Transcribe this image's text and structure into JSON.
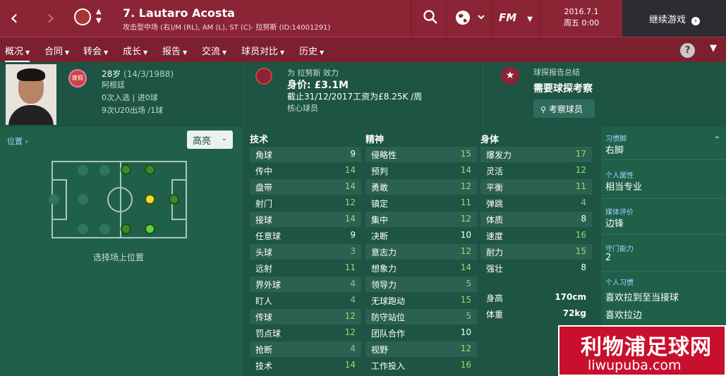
{
  "header": {
    "player_title": "7. Lautaro Acosta",
    "player_subtitle": "攻击型中场 (右)/M (RL), AM (L), ST (C)- 拉努斯 (ID:14001291)",
    "date": "2016.7.1",
    "weekday_time": "周五 0:00",
    "continue_label": "继续游戏",
    "fm_label": "FM",
    "back_icon": "chevron-left-icon",
    "forward_icon": "chevron-right-icon",
    "search_icon": "search-icon",
    "globe_icon": "globe-icon"
  },
  "tabs": [
    {
      "label": "概况",
      "active": true
    },
    {
      "label": "合同"
    },
    {
      "label": "转会"
    },
    {
      "label": "成长"
    },
    {
      "label": "报告"
    },
    {
      "label": "交流"
    },
    {
      "label": "球员对比"
    },
    {
      "label": "历史"
    }
  ],
  "help_label": "?",
  "bio": {
    "club_badge_text": "废假",
    "age": "28岁",
    "dob": "(14/3/1988)",
    "nationality": "阿根廷",
    "caps": "0次入选 | 进0球",
    "u20": "9次U20出场 /1球"
  },
  "contract": {
    "plays_for": "为 拉努斯 效力",
    "value": "身价: £3.1M",
    "wage": "截止31/12/2017工资为£8.25K /周",
    "status": "核心球员"
  },
  "scout": {
    "title": "球探报告总结",
    "status": "需要球探考察",
    "button": "考察球员"
  },
  "position": {
    "link": "位置 ›",
    "dropdown": "高亮",
    "caption": "选择场上位置"
  },
  "columns": {
    "technical": "技术",
    "mental": "精神",
    "physical": "身体"
  },
  "technical": [
    {
      "name": "角球",
      "value": "9"
    },
    {
      "name": "传中",
      "value": "14"
    },
    {
      "name": "盘带",
      "value": "14"
    },
    {
      "name": "射门",
      "value": "12"
    },
    {
      "name": "接球",
      "value": "14"
    },
    {
      "name": "任意球",
      "value": "9"
    },
    {
      "name": "头球",
      "value": "3"
    },
    {
      "name": "远射",
      "value": "11"
    },
    {
      "name": "界外球",
      "value": "4"
    },
    {
      "name": "盯人",
      "value": "4"
    },
    {
      "name": "传球",
      "value": "12"
    },
    {
      "name": "罚点球",
      "value": "12"
    },
    {
      "name": "抢断",
      "value": "4"
    },
    {
      "name": "技术",
      "value": "14"
    }
  ],
  "mental": [
    {
      "name": "侵略性",
      "value": "15"
    },
    {
      "name": "预判",
      "value": "14"
    },
    {
      "name": "勇敢",
      "value": "12"
    },
    {
      "name": "镇定",
      "value": "11"
    },
    {
      "name": "集中",
      "value": "12"
    },
    {
      "name": "决断",
      "value": "10"
    },
    {
      "name": "意志力",
      "value": "12"
    },
    {
      "name": "想象力",
      "value": "14"
    },
    {
      "name": "领导力",
      "value": "5"
    },
    {
      "name": "无球跑动",
      "value": "15"
    },
    {
      "name": "防守站位",
      "value": "5"
    },
    {
      "name": "团队合作",
      "value": "10"
    },
    {
      "name": "视野",
      "value": "12"
    },
    {
      "name": "工作投入",
      "value": "16"
    }
  ],
  "physical": [
    {
      "name": "爆发力",
      "value": "17"
    },
    {
      "name": "灵活",
      "value": "12"
    },
    {
      "name": "平衡",
      "value": "11"
    },
    {
      "name": "弹跳",
      "value": "4"
    },
    {
      "name": "体质",
      "value": "8"
    },
    {
      "name": "速度",
      "value": "16"
    },
    {
      "name": "耐力",
      "value": "15"
    },
    {
      "name": "强壮",
      "value": "8"
    }
  ],
  "physical_extra": [
    {
      "name": "身高",
      "value": "170cm"
    },
    {
      "name": "体重",
      "value": "72kg"
    }
  ],
  "traits": [
    {
      "label": "习惯脚",
      "value": "右脚"
    },
    {
      "label": "个人属性",
      "value": "相当专业"
    },
    {
      "label": "媒体评价",
      "value": "边锋"
    },
    {
      "label": "守门能力",
      "value": "2"
    },
    {
      "label": "个人习惯",
      "value": "喜欢拉到至当接球"
    },
    {
      "label": "",
      "value": "喜欢拉边"
    }
  ],
  "watermark": {
    "top": "利物浦足球网",
    "bottom": "liwupuba.com"
  },
  "colors": {
    "topbar": "#8b2434",
    "tabbar": "#7c1f2e",
    "high_value": "#8fe26b",
    "low_value": "#9bb5ad"
  }
}
